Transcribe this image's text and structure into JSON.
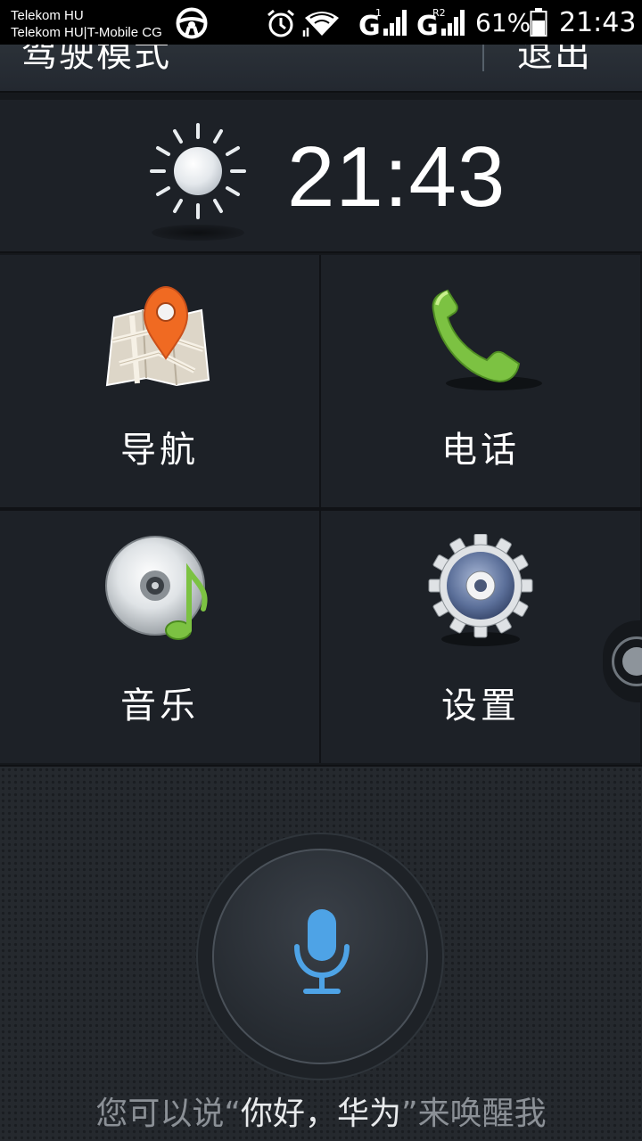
{
  "status_bar": {
    "carrier_1": "Telekom HU",
    "carrier_2": "Telekom HU|T-Mobile CG",
    "sim1_tag": "1",
    "sim2_tag": "R2",
    "network_1": "G",
    "network_2": "G",
    "battery": "61%",
    "time": "21:43"
  },
  "header": {
    "title": "驾驶模式",
    "exit_label": "退出"
  },
  "weather": {
    "icon": "sun-icon",
    "time": "21:43"
  },
  "apps": [
    {
      "label": "导航",
      "icon": "map-pin-icon"
    },
    {
      "label": "电话",
      "icon": "phone-icon"
    },
    {
      "label": "音乐",
      "icon": "music-disc-icon"
    },
    {
      "label": "设置",
      "icon": "gear-icon"
    }
  ],
  "voice": {
    "hint_prefix": "您可以说“",
    "hint_phrase": "你好，华为",
    "hint_suffix": "”来唤醒我"
  },
  "colors": {
    "accent_blue": "#4ea3e6",
    "phone_green": "#7cc242",
    "pin_orange": "#f06a22"
  }
}
